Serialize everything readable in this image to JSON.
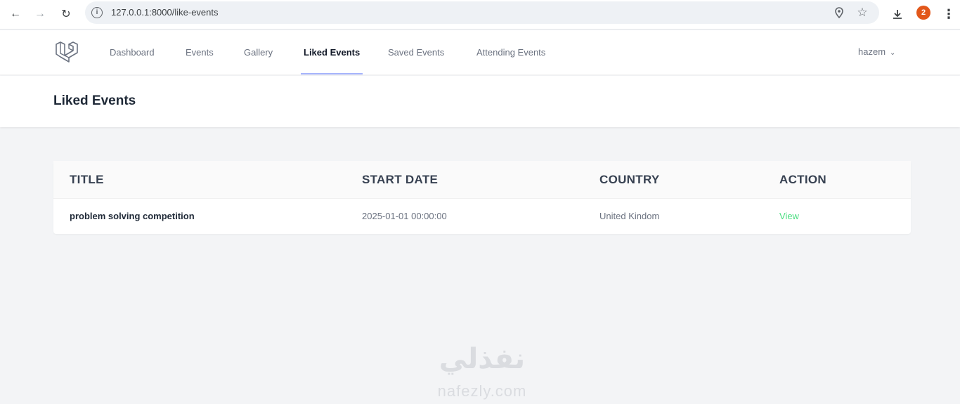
{
  "browser": {
    "url": "127.0.0.1:8000/like-events",
    "profile_initial": "2",
    "icons": {
      "back": "arrow-left-icon",
      "forward": "arrow-right-icon",
      "reload": "reload-icon",
      "site_info": "info-icon",
      "location": "location-pin-icon",
      "bookmark": "star-icon",
      "download": "download-icon",
      "menu": "kebab-menu-icon"
    }
  },
  "nav": {
    "links": [
      {
        "label": "Dashboard"
      },
      {
        "label": "Events"
      },
      {
        "label": "Gallery"
      },
      {
        "label": "Liked Events"
      },
      {
        "label": "Saved Events"
      },
      {
        "label": "Attending Events"
      }
    ],
    "active": "Liked Events",
    "user": "hazem"
  },
  "page": {
    "title": "Liked Events"
  },
  "table": {
    "headers": [
      "TITLE",
      "START DATE",
      "COUNTRY",
      "ACTION"
    ],
    "rows": [
      {
        "title": "problem solving competition",
        "start_date": "2025-01-01 00:00:00",
        "country": "United Kindom",
        "action": "View"
      }
    ]
  },
  "watermark": {
    "arabic": "نفذلي",
    "latin": "nafezly.com"
  },
  "colors": {
    "active_underline": "#a5b4fc",
    "action_link": "#4ade80",
    "page_bg": "#f3f4f6",
    "profile": "#e2571a"
  }
}
